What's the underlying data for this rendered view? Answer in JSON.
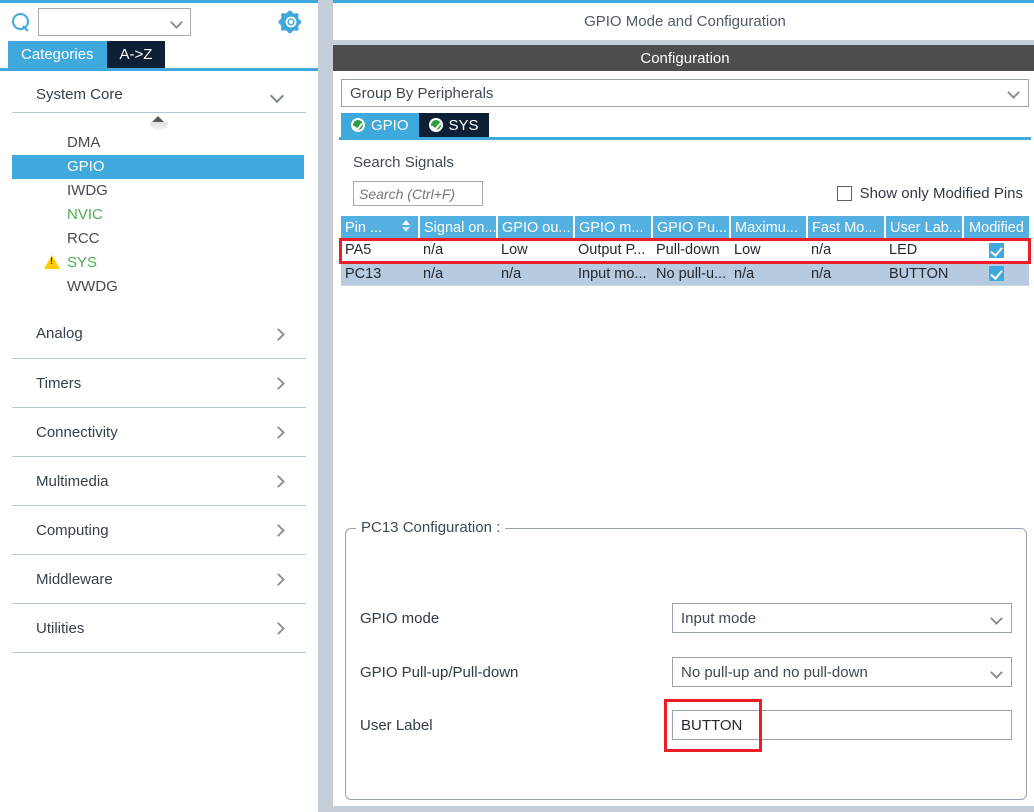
{
  "sidebar": {
    "search": {
      "value": "",
      "placeholder": ""
    },
    "search_icon": "search-icon",
    "gear_icon": "gear-icon",
    "tabs": [
      {
        "label": "Categories",
        "active": true
      },
      {
        "label": "A->Z",
        "active": false
      }
    ],
    "groups": [
      {
        "label": "System Core",
        "expanded": true,
        "items": [
          {
            "label": "DMA",
            "state": "normal"
          },
          {
            "label": "GPIO",
            "state": "selected"
          },
          {
            "label": "IWDG",
            "state": "normal"
          },
          {
            "label": "NVIC",
            "state": "configured"
          },
          {
            "label": "RCC",
            "state": "normal"
          },
          {
            "label": "SYS",
            "state": "configured",
            "warning": true
          },
          {
            "label": "WWDG",
            "state": "normal"
          }
        ]
      },
      {
        "label": "Analog",
        "expanded": false,
        "items": []
      },
      {
        "label": "Timers",
        "expanded": false,
        "items": []
      },
      {
        "label": "Connectivity",
        "expanded": false,
        "items": []
      },
      {
        "label": "Multimedia",
        "expanded": false,
        "items": []
      },
      {
        "label": "Computing",
        "expanded": false,
        "items": []
      },
      {
        "label": "Middleware",
        "expanded": false,
        "items": []
      },
      {
        "label": "Utilities",
        "expanded": false,
        "items": []
      }
    ]
  },
  "right": {
    "title": "GPIO Mode and Configuration",
    "config_header": "Configuration",
    "group_by": {
      "value": "Group By Peripherals",
      "options": [
        "Group By Peripherals"
      ]
    },
    "peripheral_tabs": [
      {
        "label": "GPIO",
        "active": true,
        "icon": "check-circle-icon"
      },
      {
        "label": "SYS",
        "active": false,
        "icon": "check-circle-icon"
      }
    ],
    "search_signals": {
      "title": "Search Signals",
      "input_value": "",
      "placeholder": "Search (Ctrl+F)"
    },
    "show_only_modified": {
      "label": "Show only Modified Pins",
      "checked": false
    },
    "table": {
      "columns": [
        "Pin ...",
        "Signal on...",
        "GPIO ou...",
        "GPIO m...",
        "GPIO Pu...",
        "Maximu...",
        "Fast Mo...",
        "User Lab...",
        "Modified"
      ],
      "sort_column": "Pin ...",
      "rows": [
        {
          "selected": false,
          "highlighted": false,
          "cells": [
            "PA5",
            "n/a",
            "Low",
            "Output P...",
            "Pull-down",
            "Low",
            "n/a",
            "LED"
          ],
          "modified": true
        },
        {
          "selected": true,
          "highlighted": true,
          "cells": [
            "PC13",
            "n/a",
            "n/a",
            "Input mo...",
            "No pull-u...",
            "n/a",
            "n/a",
            "BUTTON"
          ],
          "modified": true
        }
      ]
    },
    "pin_config": {
      "legend": "PC13 Configuration :",
      "fields": [
        {
          "label": "GPIO mode",
          "type": "select",
          "value": "Input mode",
          "highlighted": false
        },
        {
          "label": "GPIO Pull-up/Pull-down",
          "type": "select",
          "value": "No pull-up and no pull-down",
          "highlighted": false
        },
        {
          "label": "User Label",
          "type": "text",
          "value": "BUTTON",
          "highlighted": true
        }
      ]
    }
  },
  "colors": {
    "accent_blue": "#3fa9dd",
    "table_header_blue": "#54b0e0",
    "dark_tab": "#0d2035",
    "config_bar": "#4d4d4d",
    "highlight_red": "#ee1c25",
    "row_selected": "#b7cbe0",
    "warning_yellow": "#ffcc00",
    "configured_green": "#4caf50",
    "splitter_gray": "#c3ced6"
  }
}
